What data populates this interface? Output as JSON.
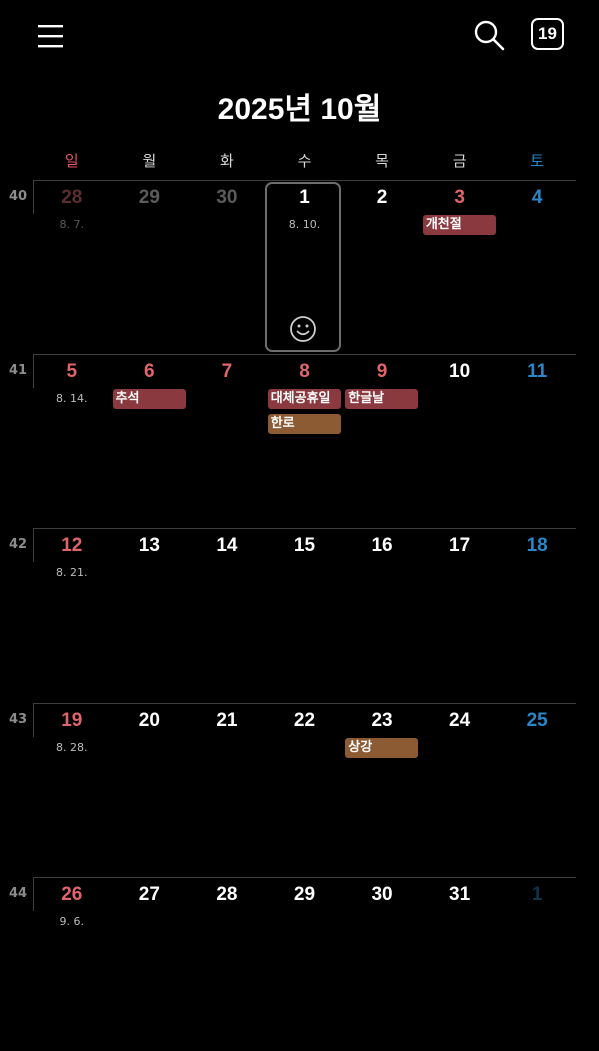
{
  "header": {
    "icons": {
      "menu": "menu-icon",
      "search": "search-icon"
    },
    "today_badge": "19"
  },
  "title": "2025년 10월",
  "weekdays": [
    "일",
    "월",
    "화",
    "수",
    "목",
    "금",
    "토"
  ],
  "today_icon": "smiley-icon",
  "colors": {
    "sunday": "#e0656b",
    "saturday": "#2a86c6",
    "event_red": "#8a3a3f",
    "event_brown": "#8c5a33"
  },
  "weeks": [
    {
      "num": "40",
      "days": [
        {
          "d": "28",
          "style": "prev-sun",
          "lunar": "8. 7.",
          "lunarDim": true
        },
        {
          "d": "29",
          "style": "prev-gray"
        },
        {
          "d": "30",
          "style": "prev-gray"
        },
        {
          "d": "1",
          "style": "",
          "lunar": "8. 10.",
          "today": true
        },
        {
          "d": "2",
          "style": ""
        },
        {
          "d": "3",
          "style": "holiday",
          "events": [
            {
              "t": "개천절",
              "c": "red"
            }
          ]
        },
        {
          "d": "4",
          "style": "sat"
        }
      ]
    },
    {
      "num": "41",
      "days": [
        {
          "d": "5",
          "style": "sun",
          "lunar": "8. 14."
        },
        {
          "d": "6",
          "style": "holiday",
          "events": [
            {
              "t": "추석",
              "c": "red"
            }
          ]
        },
        {
          "d": "7",
          "style": "holiday"
        },
        {
          "d": "8",
          "style": "holiday",
          "events": [
            {
              "t": "대체공휴일",
              "c": "red"
            },
            {
              "t": "한로",
              "c": "brown"
            }
          ]
        },
        {
          "d": "9",
          "style": "holiday",
          "events": [
            {
              "t": "한글날",
              "c": "red"
            }
          ]
        },
        {
          "d": "10",
          "style": ""
        },
        {
          "d": "11",
          "style": "sat"
        }
      ]
    },
    {
      "num": "42",
      "days": [
        {
          "d": "12",
          "style": "sun",
          "lunar": "8. 21."
        },
        {
          "d": "13",
          "style": ""
        },
        {
          "d": "14",
          "style": ""
        },
        {
          "d": "15",
          "style": ""
        },
        {
          "d": "16",
          "style": ""
        },
        {
          "d": "17",
          "style": ""
        },
        {
          "d": "18",
          "style": "sat"
        }
      ]
    },
    {
      "num": "43",
      "days": [
        {
          "d": "19",
          "style": "sun",
          "lunar": "8. 28."
        },
        {
          "d": "20",
          "style": ""
        },
        {
          "d": "21",
          "style": ""
        },
        {
          "d": "22",
          "style": ""
        },
        {
          "d": "23",
          "style": "",
          "events": [
            {
              "t": "상강",
              "c": "brown"
            }
          ]
        },
        {
          "d": "24",
          "style": ""
        },
        {
          "d": "25",
          "style": "sat"
        }
      ]
    },
    {
      "num": "44",
      "days": [
        {
          "d": "26",
          "style": "sun",
          "lunar": "9. 6."
        },
        {
          "d": "27",
          "style": ""
        },
        {
          "d": "28",
          "style": ""
        },
        {
          "d": "29",
          "style": ""
        },
        {
          "d": "30",
          "style": ""
        },
        {
          "d": "31",
          "style": ""
        },
        {
          "d": "1",
          "style": "next-sat"
        }
      ]
    }
  ]
}
